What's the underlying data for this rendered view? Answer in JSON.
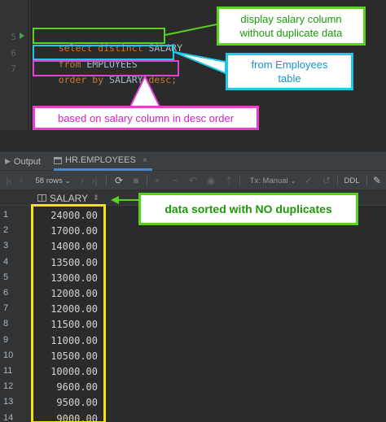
{
  "editor": {
    "line_numbers": [
      "5",
      "6",
      "7"
    ],
    "code": {
      "line1": {
        "kw1": "select distinct ",
        "col": "SALARY"
      },
      "line2": {
        "kw": "from ",
        "table": "EMPLOYEES"
      },
      "line3": {
        "kw1": "order by ",
        "col": "SALARY ",
        "kw2": "desc",
        "semi": ";"
      }
    }
  },
  "annotations": {
    "select_note": "display salary column without duplicate data",
    "from_note": "from Employees table",
    "order_note": "based on salary column in desc order",
    "result_note": "data sorted with NO duplicates",
    "colors": {
      "green": "#58d21e",
      "blue": "#1ec9e8",
      "magenta": "#e53fd0",
      "yellow": "#f5e30a",
      "callout_text_green": "#1c9a06",
      "callout_text_blue": "#1296c8",
      "callout_text_magenta": "#d21fc2"
    }
  },
  "panel": {
    "tabs": [
      {
        "label": "Output",
        "icon": "output-icon"
      },
      {
        "label": "HR.EMPLOYEES",
        "icon": "table-icon"
      }
    ],
    "toolbar": {
      "rows_label": "58 rows",
      "tx_label": "Tx: Manual",
      "ddl_label": "DDL"
    },
    "grid": {
      "column_header": "SALARY",
      "rows": [
        {
          "n": "1",
          "v": "24000.00"
        },
        {
          "n": "2",
          "v": "17000.00"
        },
        {
          "n": "3",
          "v": "14000.00"
        },
        {
          "n": "4",
          "v": "13500.00"
        },
        {
          "n": "5",
          "v": "13000.00"
        },
        {
          "n": "6",
          "v": "12008.00"
        },
        {
          "n": "7",
          "v": "12000.00"
        },
        {
          "n": "8",
          "v": "11500.00"
        },
        {
          "n": "9",
          "v": "11000.00"
        },
        {
          "n": "10",
          "v": "10500.00"
        },
        {
          "n": "11",
          "v": "10000.00"
        },
        {
          "n": "12",
          "v": "9600.00"
        },
        {
          "n": "13",
          "v": "9500.00"
        },
        {
          "n": "14",
          "v": "9000.00"
        }
      ]
    }
  }
}
